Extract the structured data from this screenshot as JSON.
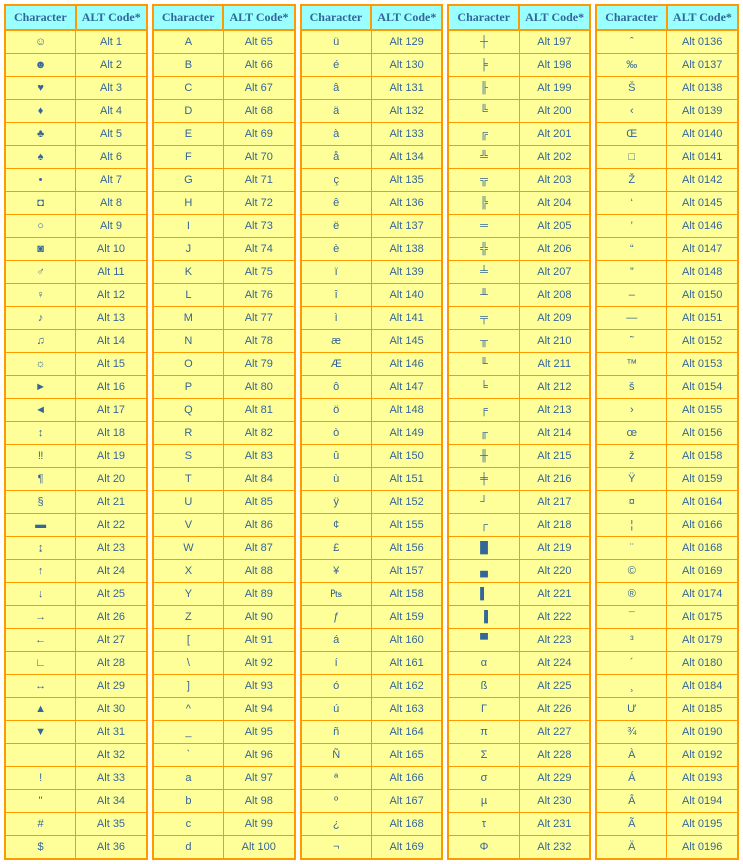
{
  "headers": {
    "char": "Character",
    "code": "ALT Code*"
  },
  "columns": [
    [
      {
        "char": "☺",
        "code": "Alt 1"
      },
      {
        "char": "☻",
        "code": "Alt 2"
      },
      {
        "char": "♥",
        "code": "Alt 3"
      },
      {
        "char": "♦",
        "code": "Alt 4"
      },
      {
        "char": "♣",
        "code": "Alt 5"
      },
      {
        "char": "♠",
        "code": "Alt 6"
      },
      {
        "char": "•",
        "code": "Alt 7"
      },
      {
        "char": "◘",
        "code": "Alt 8"
      },
      {
        "char": "○",
        "code": "Alt 9"
      },
      {
        "char": "◙",
        "code": "Alt 10"
      },
      {
        "char": "♂",
        "code": "Alt 11"
      },
      {
        "char": "♀",
        "code": "Alt 12"
      },
      {
        "char": "♪",
        "code": "Alt 13"
      },
      {
        "char": "♫",
        "code": "Alt 14"
      },
      {
        "char": "☼",
        "code": "Alt 15"
      },
      {
        "char": "►",
        "code": "Alt 16"
      },
      {
        "char": "◄",
        "code": "Alt 17"
      },
      {
        "char": "↕",
        "code": "Alt 18"
      },
      {
        "char": "‼",
        "code": "Alt 19"
      },
      {
        "char": "¶",
        "code": "Alt 20"
      },
      {
        "char": "§",
        "code": "Alt 21"
      },
      {
        "char": "▬",
        "code": "Alt 22"
      },
      {
        "char": "↨",
        "code": "Alt 23"
      },
      {
        "char": "↑",
        "code": "Alt 24"
      },
      {
        "char": "↓",
        "code": "Alt 25"
      },
      {
        "char": "→",
        "code": "Alt 26"
      },
      {
        "char": "←",
        "code": "Alt 27"
      },
      {
        "char": "∟",
        "code": "Alt 28"
      },
      {
        "char": "↔",
        "code": "Alt 29"
      },
      {
        "char": "▲",
        "code": "Alt 30"
      },
      {
        "char": "▼",
        "code": "Alt 31"
      },
      {
        "char": " ",
        "code": "Alt 32"
      },
      {
        "char": "!",
        "code": "Alt 33"
      },
      {
        "char": "\"",
        "code": "Alt 34"
      },
      {
        "char": "#",
        "code": "Alt 35"
      },
      {
        "char": "$",
        "code": "Alt 36"
      }
    ],
    [
      {
        "char": "A",
        "code": "Alt 65"
      },
      {
        "char": "B",
        "code": "Alt 66"
      },
      {
        "char": "C",
        "code": "Alt 67"
      },
      {
        "char": "D",
        "code": "Alt 68"
      },
      {
        "char": "E",
        "code": "Alt 69"
      },
      {
        "char": "F",
        "code": "Alt 70"
      },
      {
        "char": "G",
        "code": "Alt 71"
      },
      {
        "char": "H",
        "code": "Alt 72"
      },
      {
        "char": "I",
        "code": "Alt 73"
      },
      {
        "char": "J",
        "code": "Alt 74"
      },
      {
        "char": "K",
        "code": "Alt 75"
      },
      {
        "char": "L",
        "code": "Alt 76"
      },
      {
        "char": "M",
        "code": "Alt 77"
      },
      {
        "char": "N",
        "code": "Alt 78"
      },
      {
        "char": "O",
        "code": "Alt 79"
      },
      {
        "char": "P",
        "code": "Alt 80"
      },
      {
        "char": "Q",
        "code": "Alt 81"
      },
      {
        "char": "R",
        "code": "Alt 82"
      },
      {
        "char": "S",
        "code": "Alt 83"
      },
      {
        "char": "T",
        "code": "Alt 84"
      },
      {
        "char": "U",
        "code": "Alt 85"
      },
      {
        "char": "V",
        "code": "Alt 86"
      },
      {
        "char": "W",
        "code": "Alt 87"
      },
      {
        "char": "X",
        "code": "Alt 88"
      },
      {
        "char": "Y",
        "code": "Alt 89"
      },
      {
        "char": "Z",
        "code": "Alt 90"
      },
      {
        "char": "[",
        "code": "Alt 91"
      },
      {
        "char": "\\",
        "code": "Alt 92"
      },
      {
        "char": "]",
        "code": "Alt 93"
      },
      {
        "char": "^",
        "code": "Alt 94"
      },
      {
        "char": "_",
        "code": "Alt 95"
      },
      {
        "char": "`",
        "code": "Alt 96"
      },
      {
        "char": "a",
        "code": "Alt 97"
      },
      {
        "char": "b",
        "code": "Alt 98"
      },
      {
        "char": "c",
        "code": "Alt 99"
      },
      {
        "char": "d",
        "code": "Alt 100"
      }
    ],
    [
      {
        "char": "ü",
        "code": "Alt 129"
      },
      {
        "char": "é",
        "code": "Alt 130"
      },
      {
        "char": "â",
        "code": "Alt 131"
      },
      {
        "char": "ä",
        "code": "Alt 132"
      },
      {
        "char": "à",
        "code": "Alt 133"
      },
      {
        "char": "å",
        "code": "Alt 134"
      },
      {
        "char": "ç",
        "code": "Alt 135"
      },
      {
        "char": "ê",
        "code": "Alt 136"
      },
      {
        "char": "ë",
        "code": "Alt 137"
      },
      {
        "char": "è",
        "code": "Alt 138"
      },
      {
        "char": "ï",
        "code": "Alt 139"
      },
      {
        "char": "î",
        "code": "Alt 140"
      },
      {
        "char": "ì",
        "code": "Alt 141"
      },
      {
        "char": "æ",
        "code": "Alt 145"
      },
      {
        "char": "Æ",
        "code": "Alt 146"
      },
      {
        "char": "ô",
        "code": "Alt 147"
      },
      {
        "char": "ö",
        "code": "Alt 148"
      },
      {
        "char": "ò",
        "code": "Alt 149"
      },
      {
        "char": "û",
        "code": "Alt 150"
      },
      {
        "char": "ù",
        "code": "Alt 151"
      },
      {
        "char": "ÿ",
        "code": "Alt 152"
      },
      {
        "char": "¢",
        "code": "Alt 155"
      },
      {
        "char": "£",
        "code": "Alt 156"
      },
      {
        "char": "¥",
        "code": "Alt 157"
      },
      {
        "char": "₧",
        "code": "Alt 158"
      },
      {
        "char": "ƒ",
        "code": "Alt 159"
      },
      {
        "char": "á",
        "code": "Alt 160"
      },
      {
        "char": "í",
        "code": "Alt 161"
      },
      {
        "char": "ó",
        "code": "Alt 162"
      },
      {
        "char": "ú",
        "code": "Alt 163"
      },
      {
        "char": "ñ",
        "code": "Alt 164"
      },
      {
        "char": "Ñ",
        "code": "Alt 165"
      },
      {
        "char": "ª",
        "code": "Alt 166"
      },
      {
        "char": "º",
        "code": "Alt 167"
      },
      {
        "char": "¿",
        "code": "Alt 168"
      },
      {
        "char": "¬",
        "code": "Alt 169"
      }
    ],
    [
      {
        "char": "┼",
        "code": "Alt 197"
      },
      {
        "char": "╞",
        "code": "Alt 198"
      },
      {
        "char": "╟",
        "code": "Alt 199"
      },
      {
        "char": "╚",
        "code": "Alt 200"
      },
      {
        "char": "╔",
        "code": "Alt 201"
      },
      {
        "char": "╩",
        "code": "Alt 202"
      },
      {
        "char": "╦",
        "code": "Alt 203"
      },
      {
        "char": "╠",
        "code": "Alt 204"
      },
      {
        "char": "═",
        "code": "Alt 205"
      },
      {
        "char": "╬",
        "code": "Alt 206"
      },
      {
        "char": "╧",
        "code": "Alt 207"
      },
      {
        "char": "╨",
        "code": "Alt 208"
      },
      {
        "char": "╤",
        "code": "Alt 209"
      },
      {
        "char": "╥",
        "code": "Alt 210"
      },
      {
        "char": "╙",
        "code": "Alt 211"
      },
      {
        "char": "╘",
        "code": "Alt 212"
      },
      {
        "char": "╒",
        "code": "Alt 213"
      },
      {
        "char": "╓",
        "code": "Alt 214"
      },
      {
        "char": "╫",
        "code": "Alt 215"
      },
      {
        "char": "╪",
        "code": "Alt 216"
      },
      {
        "char": "┘",
        "code": "Alt 217"
      },
      {
        "char": "┌",
        "code": "Alt 218"
      },
      {
        "char": "█",
        "code": "Alt 219"
      },
      {
        "char": "▄",
        "code": "Alt 220"
      },
      {
        "char": "▌",
        "code": "Alt 221"
      },
      {
        "char": "▐",
        "code": "Alt 222"
      },
      {
        "char": "▀",
        "code": "Alt 223"
      },
      {
        "char": "α",
        "code": "Alt 224"
      },
      {
        "char": "ß",
        "code": "Alt 225"
      },
      {
        "char": "Γ",
        "code": "Alt 226"
      },
      {
        "char": "π",
        "code": "Alt 227"
      },
      {
        "char": "Σ",
        "code": "Alt 228"
      },
      {
        "char": "σ",
        "code": "Alt 229"
      },
      {
        "char": "µ",
        "code": "Alt 230"
      },
      {
        "char": "τ",
        "code": "Alt 231"
      },
      {
        "char": "Φ",
        "code": "Alt 232"
      }
    ],
    [
      {
        "char": "ˆ",
        "code": "Alt 0136"
      },
      {
        "char": "‰",
        "code": "Alt 0137"
      },
      {
        "char": "Š",
        "code": "Alt 0138"
      },
      {
        "char": "‹",
        "code": "Alt 0139"
      },
      {
        "char": "Œ",
        "code": "Alt 0140"
      },
      {
        "char": "□",
        "code": "Alt 0141"
      },
      {
        "char": "Ž",
        "code": "Alt 0142"
      },
      {
        "char": "‘",
        "code": "Alt 0145"
      },
      {
        "char": "’",
        "code": "Alt 0146"
      },
      {
        "char": "“",
        "code": "Alt 0147"
      },
      {
        "char": "”",
        "code": "Alt 0148"
      },
      {
        "char": "–",
        "code": "Alt 0150"
      },
      {
        "char": "—",
        "code": "Alt 0151"
      },
      {
        "char": "˜",
        "code": "Alt 0152"
      },
      {
        "char": "™",
        "code": "Alt 0153"
      },
      {
        "char": "š",
        "code": "Alt 0154"
      },
      {
        "char": "›",
        "code": "Alt 0155"
      },
      {
        "char": "œ",
        "code": "Alt 0156"
      },
      {
        "char": "ž",
        "code": "Alt 0158"
      },
      {
        "char": "Ÿ",
        "code": "Alt 0159"
      },
      {
        "char": "¤",
        "code": "Alt 0164"
      },
      {
        "char": "¦",
        "code": "Alt 0166"
      },
      {
        "char": "¨",
        "code": "Alt 0168"
      },
      {
        "char": "©",
        "code": "Alt 0169"
      },
      {
        "char": "®",
        "code": "Alt 0174"
      },
      {
        "char": "¯",
        "code": "Alt 0175"
      },
      {
        "char": "³",
        "code": "Alt 0179"
      },
      {
        "char": "´",
        "code": "Alt 0180"
      },
      {
        "char": "¸",
        "code": "Alt 0184"
      },
      {
        "char": "Ư",
        "code": "Alt 0185"
      },
      {
        "char": "¾",
        "code": "Alt 0190"
      },
      {
        "char": "À",
        "code": "Alt 0192"
      },
      {
        "char": "Á",
        "code": "Alt 0193"
      },
      {
        "char": "Â",
        "code": "Alt 0194"
      },
      {
        "char": "Ã",
        "code": "Alt 0195"
      },
      {
        "char": "Ä",
        "code": "Alt 0196"
      }
    ]
  ]
}
